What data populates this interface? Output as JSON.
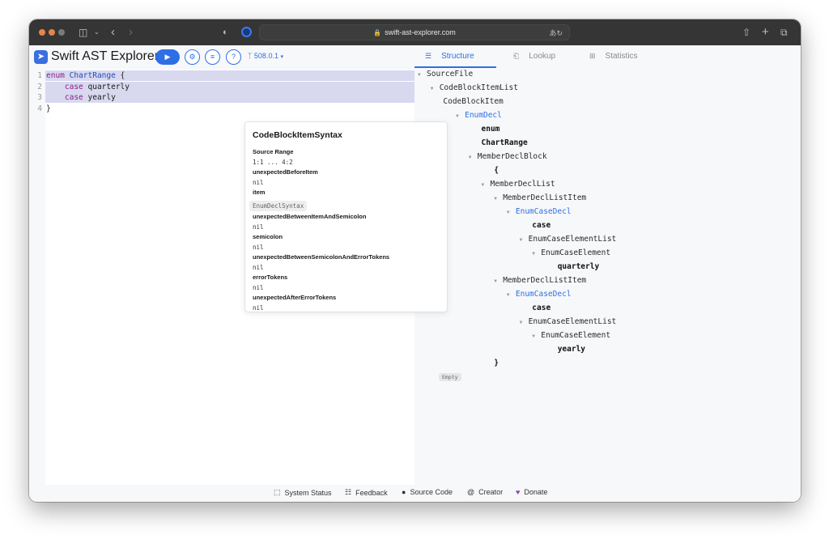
{
  "browser": {
    "url": "swift-ast-explorer.com",
    "traffic_lights": [
      "#e8834a",
      "#e8834a",
      "#7a7a7a"
    ]
  },
  "header": {
    "title": "Swift AST Explorer",
    "run_icon": "play-icon",
    "settings_icon": "gear-icon",
    "format_icon": "format-icon",
    "help_label": "?",
    "version": "508.0.1"
  },
  "editor": {
    "lines": [
      {
        "num": "1",
        "tokens": [
          {
            "t": "enum",
            "c": "kw"
          },
          {
            "t": " "
          },
          {
            "t": "ChartRange",
            "c": "ty"
          },
          {
            "t": " {"
          }
        ]
      },
      {
        "num": "2",
        "tokens": [
          {
            "t": "    "
          },
          {
            "t": "case",
            "c": "kw"
          },
          {
            "t": " quarterly"
          }
        ]
      },
      {
        "num": "3",
        "tokens": [
          {
            "t": "    "
          },
          {
            "t": "case",
            "c": "kw"
          },
          {
            "t": " yearly"
          }
        ]
      },
      {
        "num": "4",
        "tokens": [
          {
            "t": "}"
          }
        ]
      }
    ]
  },
  "popover": {
    "title": "CodeBlockItemSyntax",
    "fields": [
      {
        "label": "Source Range",
        "value": "1:1 ... 4:2"
      },
      {
        "label": "unexpectedBeforeItem",
        "value": "nil"
      },
      {
        "label": "item",
        "value": "EnumDeclSyntax",
        "chip": true
      },
      {
        "label": "unexpectedBetweenItemAndSemicolon",
        "value": "nil"
      },
      {
        "label": "semicolon",
        "value": "nil"
      },
      {
        "label": "unexpectedBetweenSemicolonAndErrorTokens",
        "value": "nil"
      },
      {
        "label": "errorTokens",
        "value": "nil"
      },
      {
        "label": "unexpectedAfterErrorTokens",
        "value": "nil"
      }
    ]
  },
  "tabs": [
    {
      "label": "Structure",
      "icon": "structure-icon",
      "active": true
    },
    {
      "label": "Lookup",
      "icon": "document-icon",
      "active": false
    },
    {
      "label": "Statistics",
      "icon": "table-icon",
      "active": false
    }
  ],
  "tree": [
    {
      "label": "SourceFile",
      "depth": 0,
      "toggle": true
    },
    {
      "label": "CodeBlockItemList",
      "depth": 1,
      "toggle": true
    },
    {
      "label": "CodeBlockItem",
      "depth": 2,
      "toggle": false
    },
    {
      "label": "EnumDecl",
      "depth": 3,
      "toggle": true,
      "style": "blue"
    },
    {
      "label": "enum",
      "depth": 5,
      "toggle": false,
      "style": "bold"
    },
    {
      "label": "ChartRange",
      "depth": 5,
      "toggle": false,
      "style": "bold"
    },
    {
      "label": "MemberDeclBlock",
      "depth": 4,
      "toggle": true
    },
    {
      "label": "{",
      "depth": 6,
      "toggle": false,
      "style": "bold"
    },
    {
      "label": "MemberDeclList",
      "depth": 5,
      "toggle": true
    },
    {
      "label": "MemberDeclListItem",
      "depth": 6,
      "toggle": true
    },
    {
      "label": "EnumCaseDecl",
      "depth": 7,
      "toggle": true,
      "style": "blue"
    },
    {
      "label": "case",
      "depth": 9,
      "toggle": false,
      "style": "bold"
    },
    {
      "label": "EnumCaseElementList",
      "depth": 8,
      "toggle": true
    },
    {
      "label": "EnumCaseElement",
      "depth": 9,
      "toggle": true
    },
    {
      "label": "quarterly",
      "depth": 11,
      "toggle": false,
      "style": "bold"
    },
    {
      "label": "MemberDeclListItem",
      "depth": 6,
      "toggle": true
    },
    {
      "label": "EnumCaseDecl",
      "depth": 7,
      "toggle": true,
      "style": "blue"
    },
    {
      "label": "case",
      "depth": 9,
      "toggle": false,
      "style": "bold"
    },
    {
      "label": "EnumCaseElementList",
      "depth": 8,
      "toggle": true
    },
    {
      "label": "EnumCaseElement",
      "depth": 9,
      "toggle": true
    },
    {
      "label": "yearly",
      "depth": 11,
      "toggle": false,
      "style": "bold"
    },
    {
      "label": "}",
      "depth": 6,
      "toggle": false,
      "style": "bold"
    }
  ],
  "empty_badge": "Empty",
  "footer": [
    {
      "label": "System Status",
      "icon": "status-icon"
    },
    {
      "label": "Feedback",
      "icon": "feedback-icon"
    },
    {
      "label": "Source Code",
      "icon": "github-icon"
    },
    {
      "label": "Creator",
      "icon": "at-icon"
    },
    {
      "label": "Donate",
      "icon": "heart-icon"
    }
  ]
}
